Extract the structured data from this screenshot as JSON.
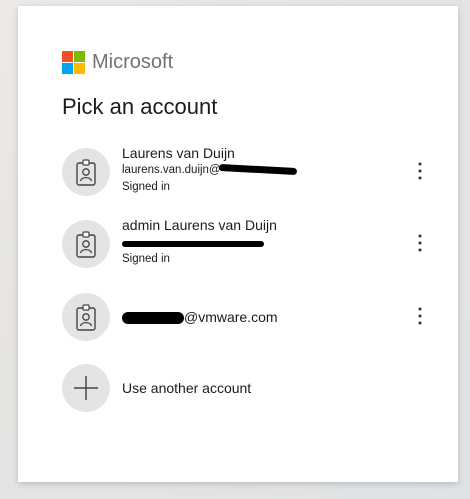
{
  "brand": {
    "name": "Microsoft",
    "logo_colors": [
      "#f25022",
      "#7fba00",
      "#00a4ef",
      "#ffb900"
    ]
  },
  "title": "Pick an account",
  "accounts": [
    {
      "name": "Laurens van Duijn",
      "email": "laurens.van.duijn@",
      "status": "Signed in",
      "icon": "id-badge-icon",
      "more_icon": "more-vertical-icon"
    },
    {
      "name": "admin Laurens van Duijn",
      "email": "",
      "status": "Signed in",
      "icon": "id-badge-icon",
      "more_icon": "more-vertical-icon"
    },
    {
      "email_suffix": "@vmware.com",
      "icon": "id-badge-icon",
      "more_icon": "more-vertical-icon"
    }
  ],
  "add_account": {
    "label": "Use another account",
    "icon": "plus-icon"
  }
}
